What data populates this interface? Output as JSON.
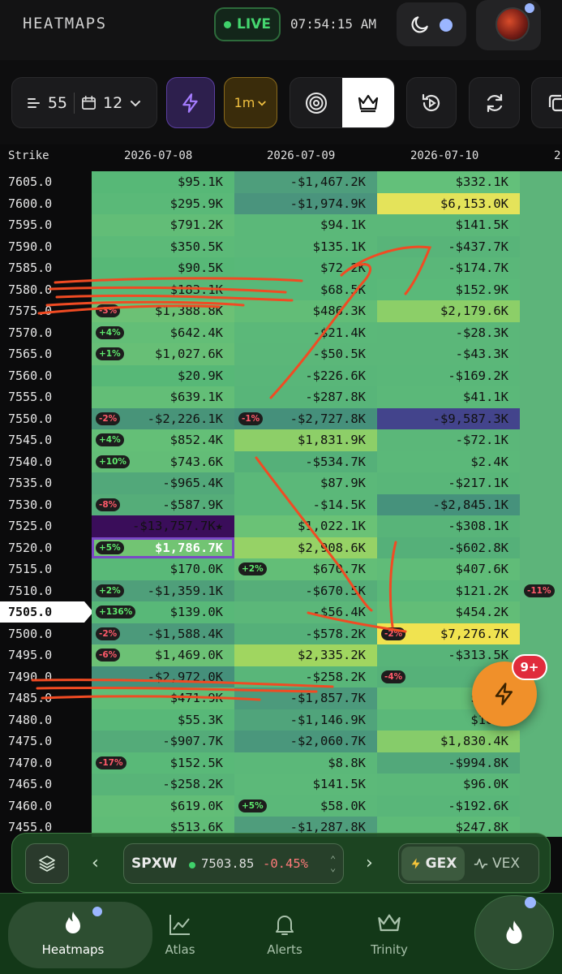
{
  "header": {
    "title": "HEATMAPS",
    "live_label": "LIVE",
    "time": "07:54:15 AM"
  },
  "toolbar": {
    "strikes_count": "55",
    "days_count": "12",
    "interval": "1m"
  },
  "columns": {
    "strike": "Strike",
    "dates": [
      "2026-07-08",
      "2026-07-09",
      "2026-07-10",
      "2"
    ]
  },
  "current_strike": "7505.0",
  "selected_cell": {
    "row": 17,
    "col": 0
  },
  "rows": [
    {
      "s": "7605.0",
      "c": [
        {
          "v": "$95.1K"
        },
        {
          "v": "-$1,467.2K"
        },
        {
          "v": "$332.1K"
        },
        {
          "v": ""
        }
      ]
    },
    {
      "s": "7600.0",
      "c": [
        {
          "v": "$295.9K"
        },
        {
          "v": "-$1,974.9K"
        },
        {
          "v": "$6,153.0K"
        },
        {
          "v": ""
        }
      ]
    },
    {
      "s": "7595.0",
      "c": [
        {
          "v": "$791.2K"
        },
        {
          "v": "$94.1K"
        },
        {
          "v": "$141.5K"
        },
        {
          "v": ""
        }
      ]
    },
    {
      "s": "7590.0",
      "c": [
        {
          "v": "$350.5K"
        },
        {
          "v": "$135.1K"
        },
        {
          "v": "-$437.7K"
        },
        {
          "v": ""
        }
      ]
    },
    {
      "s": "7585.0",
      "c": [
        {
          "v": "$90.5K"
        },
        {
          "v": "$72.2K"
        },
        {
          "v": "-$174.7K"
        },
        {
          "v": ""
        }
      ]
    },
    {
      "s": "7580.0",
      "c": [
        {
          "v": "$183.1K"
        },
        {
          "v": "$68.5K"
        },
        {
          "v": "$152.9K"
        },
        {
          "v": ""
        }
      ]
    },
    {
      "s": "7575.0",
      "c": [
        {
          "v": "$1,388.8K",
          "p": "-3%"
        },
        {
          "v": "$486.3K"
        },
        {
          "v": "$2,179.6K"
        },
        {
          "v": ""
        }
      ]
    },
    {
      "s": "7570.0",
      "c": [
        {
          "v": "$642.4K",
          "p": "+4%"
        },
        {
          "v": "-$21.4K"
        },
        {
          "v": "-$28.3K"
        },
        {
          "v": ""
        }
      ]
    },
    {
      "s": "7565.0",
      "c": [
        {
          "v": "$1,027.6K",
          "p": "+1%"
        },
        {
          "v": "-$50.5K"
        },
        {
          "v": "-$43.3K"
        },
        {
          "v": ""
        }
      ]
    },
    {
      "s": "7560.0",
      "c": [
        {
          "v": "$20.9K"
        },
        {
          "v": "-$226.6K"
        },
        {
          "v": "-$169.2K"
        },
        {
          "v": ""
        }
      ]
    },
    {
      "s": "7555.0",
      "c": [
        {
          "v": "$639.1K"
        },
        {
          "v": "-$287.8K"
        },
        {
          "v": "$41.1K"
        },
        {
          "v": ""
        }
      ]
    },
    {
      "s": "7550.0",
      "c": [
        {
          "v": "-$2,226.1K",
          "p": "-2%"
        },
        {
          "v": "-$2,727.8K",
          "p": "-1%"
        },
        {
          "v": "-$9,587.3K"
        },
        {
          "v": ""
        }
      ]
    },
    {
      "s": "7545.0",
      "c": [
        {
          "v": "$852.4K",
          "p": "+4%"
        },
        {
          "v": "$1,831.9K"
        },
        {
          "v": "-$72.1K"
        },
        {
          "v": ""
        }
      ]
    },
    {
      "s": "7540.0",
      "c": [
        {
          "v": "$743.6K",
          "p": "+10%"
        },
        {
          "v": "-$534.7K"
        },
        {
          "v": "$2.4K"
        },
        {
          "v": ""
        }
      ]
    },
    {
      "s": "7535.0",
      "c": [
        {
          "v": "-$965.4K"
        },
        {
          "v": "$87.9K"
        },
        {
          "v": "-$217.1K"
        },
        {
          "v": ""
        }
      ]
    },
    {
      "s": "7530.0",
      "c": [
        {
          "v": "-$587.9K",
          "p": "-8%"
        },
        {
          "v": "-$14.5K"
        },
        {
          "v": "-$2,845.1K"
        },
        {
          "v": ""
        }
      ]
    },
    {
      "s": "7525.0",
      "c": [
        {
          "v": "-$13,757.7K★"
        },
        {
          "v": "$1,022.1K"
        },
        {
          "v": "-$308.1K"
        },
        {
          "v": ""
        }
      ]
    },
    {
      "s": "7520.0",
      "c": [
        {
          "v": "$1,786.7K",
          "p": "+5%"
        },
        {
          "v": "$2,908.6K"
        },
        {
          "v": "-$602.8K"
        },
        {
          "v": ""
        }
      ]
    },
    {
      "s": "7515.0",
      "c": [
        {
          "v": "$170.0K"
        },
        {
          "v": "$670.7K",
          "p": "+2%"
        },
        {
          "v": "$407.6K"
        },
        {
          "v": ""
        }
      ]
    },
    {
      "s": "7510.0",
      "c": [
        {
          "v": "-$1,359.1K",
          "p": "+2%"
        },
        {
          "v": "-$670.5K"
        },
        {
          "v": "$121.2K"
        },
        {
          "v": "",
          "p": "-11%"
        }
      ]
    },
    {
      "s": "7505.0",
      "c": [
        {
          "v": "$139.0K",
          "p": "+136%"
        },
        {
          "v": "-$56.4K"
        },
        {
          "v": "$454.2K"
        },
        {
          "v": ""
        }
      ]
    },
    {
      "s": "7500.0",
      "c": [
        {
          "v": "-$1,588.4K",
          "p": "-2%"
        },
        {
          "v": "-$578.2K"
        },
        {
          "v": "$7,276.7K",
          "p": "-2%"
        },
        {
          "v": ""
        }
      ]
    },
    {
      "s": "7495.0",
      "c": [
        {
          "v": "$1,469.0K",
          "p": "-6%"
        },
        {
          "v": "$2,335.2K"
        },
        {
          "v": "-$313.5K"
        },
        {
          "v": ""
        }
      ]
    },
    {
      "s": "7490.0",
      "c": [
        {
          "v": "-$2,972.0K"
        },
        {
          "v": "-$258.2K"
        },
        {
          "v": "-$76",
          "p": "-4%"
        },
        {
          "v": ""
        }
      ]
    },
    {
      "s": "7485.0",
      "c": [
        {
          "v": "$471.9K"
        },
        {
          "v": "-$1,857.7K"
        },
        {
          "v": "$1,08"
        },
        {
          "v": ""
        }
      ]
    },
    {
      "s": "7480.0",
      "c": [
        {
          "v": "$55.3K"
        },
        {
          "v": "-$1,146.9K"
        },
        {
          "v": "$100."
        },
        {
          "v": ""
        }
      ]
    },
    {
      "s": "7475.0",
      "c": [
        {
          "v": "-$907.7K"
        },
        {
          "v": "-$2,060.7K"
        },
        {
          "v": "$1,830.4K"
        },
        {
          "v": ""
        }
      ]
    },
    {
      "s": "7470.0",
      "c": [
        {
          "v": "$152.5K",
          "p": "-17%"
        },
        {
          "v": "$8.8K"
        },
        {
          "v": "-$994.8K"
        },
        {
          "v": ""
        }
      ]
    },
    {
      "s": "7465.0",
      "c": [
        {
          "v": "-$258.2K"
        },
        {
          "v": "$141.5K"
        },
        {
          "v": "$96.0K"
        },
        {
          "v": ""
        }
      ]
    },
    {
      "s": "7460.0",
      "c": [
        {
          "v": "$619.0K"
        },
        {
          "v": "$58.0K",
          "p": "+5%"
        },
        {
          "v": "-$192.6K"
        },
        {
          "v": ""
        }
      ]
    },
    {
      "s": "7455.0",
      "c": [
        {
          "v": "$513.6K"
        },
        {
          "v": "-$1,287.8K"
        },
        {
          "v": "$247.8K"
        },
        {
          "v": ""
        }
      ]
    }
  ],
  "colors": {
    "cells": [
      [
        "#57b877",
        "#4e9e7c",
        "#63c07a",
        "#5db47a"
      ],
      [
        "#5ab978",
        "#4a947d",
        "#e4e35a",
        "#5db47a"
      ],
      [
        "#62bd77",
        "#5bb879",
        "#5bb879",
        "#5db47a"
      ],
      [
        "#5cba78",
        "#5bb879",
        "#58b479",
        "#5db47a"
      ],
      [
        "#57b877",
        "#58b879",
        "#5ab779",
        "#5db47a"
      ],
      [
        "#58b878",
        "#58b879",
        "#5ab979",
        "#5db47a"
      ],
      [
        "#6cc175",
        "#62bd77",
        "#8ccf68",
        "#5db47a"
      ],
      [
        "#63be77",
        "#5bb879",
        "#5bb779",
        "#5db47a"
      ],
      [
        "#67bf76",
        "#5bb779",
        "#5bb779",
        "#5db47a"
      ],
      [
        "#57b877",
        "#59b679",
        "#5ab779",
        "#5db47a"
      ],
      [
        "#63be77",
        "#58b579",
        "#5bb879",
        "#5db47a"
      ],
      [
        "#489479",
        "#45907b",
        "#43448c",
        "#5db47a"
      ],
      [
        "#64bf77",
        "#8dcf68",
        "#5bb779",
        "#5db47a"
      ],
      [
        "#63bd77",
        "#55b079",
        "#5bb879",
        "#5db47a"
      ],
      [
        "#52a87a",
        "#5bb879",
        "#59b679",
        "#5db47a"
      ],
      [
        "#55ad79",
        "#5bb879",
        "#46927c",
        "#5db47a"
      ],
      [
        "#3a0d5a",
        "#6ac276",
        "#58b479",
        "#5db47a"
      ],
      [
        "#72c473",
        "#96d266",
        "#55b079",
        "#5db47a"
      ],
      [
        "#59b978",
        "#63be77",
        "#60bc78",
        "#5db47a"
      ],
      [
        "#4f9f7a",
        "#56ae79",
        "#5ab879",
        "#5db47a"
      ],
      [
        "#58b878",
        "#5bb779",
        "#62bd77",
        "#5db47a"
      ],
      [
        "#4c9a7b",
        "#55b079",
        "#f0e350",
        "#5db47a"
      ],
      [
        "#6cc175",
        "#a0d660",
        "#58b479",
        "#5db47a"
      ],
      [
        "#45907b",
        "#59b679",
        "#56b179",
        "#5db47a"
      ],
      [
        "#60bd77",
        "#4c9a7c",
        "#64be77",
        "#5db47a"
      ],
      [
        "#58b878",
        "#50a47b",
        "#5bb879",
        "#5db47a"
      ],
      [
        "#54ab79",
        "#4a977c",
        "#86cc6a",
        "#5db47a"
      ],
      [
        "#59b978",
        "#5bb879",
        "#52a87a",
        "#5db47a"
      ],
      [
        "#58b478",
        "#5cb979",
        "#5bb879",
        "#5db47a"
      ],
      [
        "#62bd77",
        "#5bb879",
        "#59b679",
        "#5db47a"
      ],
      [
        "#60bc77",
        "#4f9d7c",
        "#5ebb78",
        "#5db47a"
      ]
    ]
  },
  "fab": {
    "badge": "9+"
  },
  "ticker": {
    "symbol": "SPXW",
    "price": "7503.85",
    "change": "-0.45%",
    "gex_label": "GEX",
    "vex_label": "VEX"
  },
  "nav": {
    "heatmaps": "Heatmaps",
    "atlas": "Atlas",
    "alerts": "Alerts",
    "trinity": "Trinity"
  },
  "icons": [
    "menu-lines-icon",
    "calendar-icon",
    "chevron-down-icon",
    "bolt-icon",
    "target-icon",
    "crown-icon",
    "replay-icon",
    "refresh-icon",
    "copy-icon",
    "moon-icon",
    "layers-icon",
    "flame-icon",
    "chart-icon",
    "bell-icon"
  ]
}
